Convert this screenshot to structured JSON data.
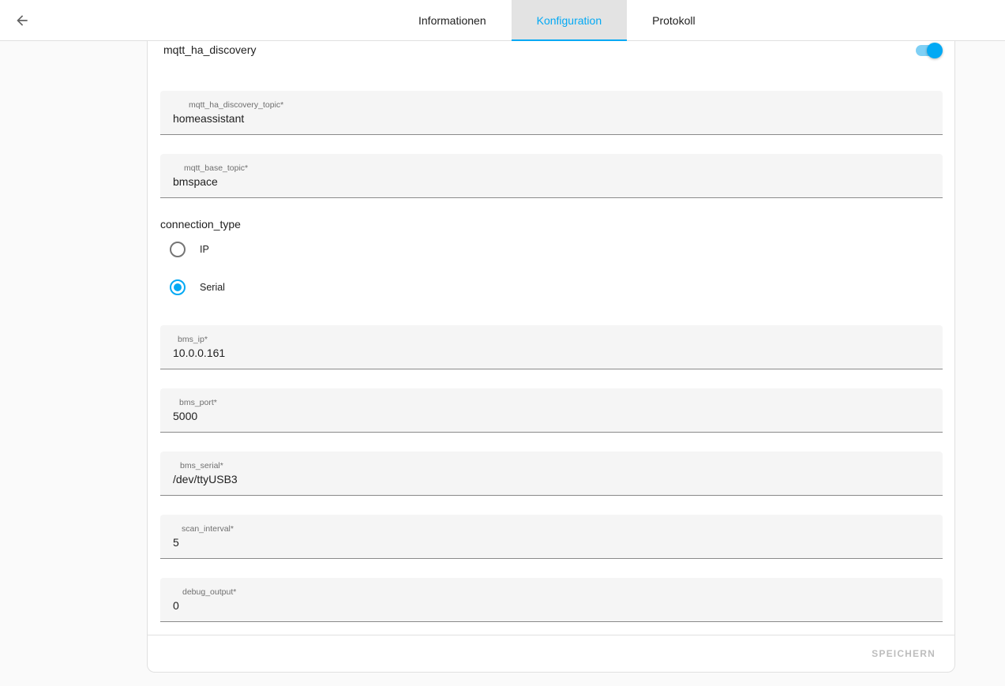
{
  "header": {
    "back_icon": "arrow-left-icon",
    "tabs": [
      {
        "label": "Informationen",
        "active": false
      },
      {
        "label": "Konfiguration",
        "active": true
      },
      {
        "label": "Protokoll",
        "active": false
      }
    ]
  },
  "config": {
    "mqtt_ha_discovery": {
      "label": "mqtt_ha_discovery",
      "enabled": true
    },
    "fields": {
      "discovery_topic": {
        "label": "mqtt_ha_discovery_topic*",
        "value": "homeassistant"
      },
      "base_topic": {
        "label": "mqtt_base_topic*",
        "value": "bmspace"
      },
      "bms_ip": {
        "label": "bms_ip*",
        "value": "10.0.0.161"
      },
      "bms_port": {
        "label": "bms_port*",
        "value": "5000"
      },
      "bms_serial": {
        "label": "bms_serial*",
        "value": "/dev/ttyUSB3"
      },
      "scan_interval": {
        "label": "scan_interval*",
        "value": "5"
      },
      "debug_output": {
        "label": "debug_output*",
        "value": "0"
      }
    },
    "connection_type": {
      "label": "connection_type",
      "options": [
        {
          "label": "IP",
          "checked": false
        },
        {
          "label": "Serial",
          "checked": true
        }
      ]
    }
  },
  "actions": {
    "save_label": "SPEICHERN"
  },
  "colors": {
    "accent": "#03a9f4",
    "disabled": "#bdbdbd"
  }
}
